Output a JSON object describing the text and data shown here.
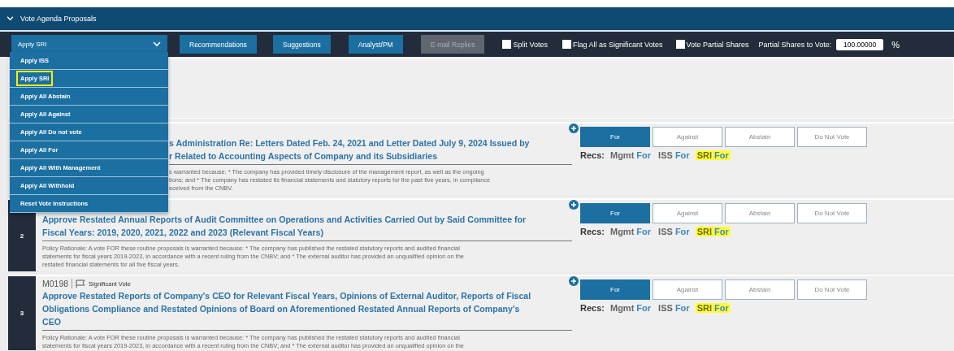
{
  "section": {
    "title": "Vote Agenda Proposals",
    "expanded": true
  },
  "toolbar": {
    "select": {
      "value": "Apply SRI",
      "open": true
    },
    "buttons": [
      {
        "label": "Recommendations",
        "disabled": false
      },
      {
        "label": "Suggestions",
        "disabled": false
      },
      {
        "label": "Analyst/PM",
        "disabled": false
      },
      {
        "label": "E-mail Replies",
        "disabled": true
      }
    ],
    "checkboxes": [
      {
        "label": "Split Votes",
        "checked": false
      },
      {
        "label": "Flag All as Significant Votes",
        "checked": false
      },
      {
        "label": "Vote Partial Shares",
        "checked": false
      }
    ],
    "partial_shares": {
      "label": "Partial Shares to Vote:",
      "value": "100.00000",
      "unit": "%"
    }
  },
  "dropdown": [
    {
      "label": "Apply ISS",
      "highlighted": false
    },
    {
      "label": "Apply SRI",
      "highlighted": true
    },
    {
      "label": "Apply All Abstain",
      "highlighted": false
    },
    {
      "label": "Apply All Against",
      "highlighted": false
    },
    {
      "label": "Apply All Do not vote",
      "highlighted": false
    },
    {
      "label": "Apply All For",
      "highlighted": false
    },
    {
      "label": "Apply All With Management",
      "highlighted": false
    },
    {
      "label": "Apply All Withhold",
      "highlighted": false
    },
    {
      "label": "Reset Vote Instructions",
      "highlighted": false
    }
  ],
  "proposals": [
    {
      "title": "s Administration Re: Letters Dated Feb. 24, 2021 and Letter Dated July 9, 2024 Issued by\nr Related to Accounting Aspects of Company and its Subsidiaries",
      "rationale": "s warranted because: * The company has provided timely disclosure of the management report, as well as the ongoing\ntions; and * The company has restated its financial statements and statutory reports for the past five years, in compliance\neceived from the CNBV.",
      "votes": [
        {
          "label": "For",
          "selected": true
        },
        {
          "label": "Against",
          "selected": false
        },
        {
          "label": "Abstain",
          "selected": false
        },
        {
          "label": "Do Not Vote",
          "selected": false
        }
      ],
      "recs_label": "Recs:",
      "recs": [
        {
          "source": "Mgmt",
          "value": "For",
          "highlighted": false
        },
        {
          "source": "ISS",
          "value": "For",
          "highlighted": false
        },
        {
          "source": "SRI",
          "value": "For",
          "highlighted": true
        }
      ]
    },
    {
      "number": "2",
      "title": "Approve Restated Annual Reports of Audit Committee on Operations and Activities Carried Out by Said Committee for\nFiscal Years: 2019, 2020, 2021, 2022 and 2023 (Relevant Fiscal Years)",
      "rationale": "Policy Rationale: A vote FOR these routine proposals is warranted because: * The company has published the restated statutory reports and audited financial\nstatements for fiscal years 2019-2023, in accordance with a recent ruling from the CNBV; and * The external auditor has provided an unqualified opinion on the\nrestated financial statements for all five fiscal years.",
      "votes": [
        {
          "label": "For",
          "selected": true
        },
        {
          "label": "Against",
          "selected": false
        },
        {
          "label": "Abstain",
          "selected": false
        },
        {
          "label": "Do Not Vote",
          "selected": false
        }
      ],
      "recs_label": "Recs:",
      "recs": [
        {
          "source": "Mgmt",
          "value": "For",
          "highlighted": false
        },
        {
          "source": "ISS",
          "value": "For",
          "highlighted": false
        },
        {
          "source": "SRI",
          "value": "For",
          "highlighted": true
        }
      ]
    },
    {
      "number": "3",
      "code": "M0198",
      "significant": true,
      "significant_label": "Significant Vote",
      "title": "Approve Restated Reports of Company's CEO for Relevant Fiscal Years, Opinions of External Auditor, Reports of Fiscal\nObligations Compliance and Restated Opinions of Board on Aforementioned Restated Annual Reports of Company's\nCEO",
      "rationale": "Policy Rationale: A vote FOR these routine proposals is warranted because: * The company has published the restated statutory reports and audited financial\nstatements for fiscal years 2019-2023, in accordance with a recent ruling from the CNBV; and * The external auditor has provided an unqualified opinion on the",
      "votes": [
        {
          "label": "For",
          "selected": true
        },
        {
          "label": "Against",
          "selected": false
        },
        {
          "label": "Abstain",
          "selected": false
        },
        {
          "label": "Do Not Vote",
          "selected": false
        }
      ],
      "recs_label": "Recs:",
      "recs": [
        {
          "source": "Mgmt",
          "value": "For",
          "highlighted": false
        },
        {
          "source": "ISS",
          "value": "For",
          "highlighted": false
        },
        {
          "source": "SRI",
          "value": "For",
          "highlighted": true
        }
      ]
    }
  ]
}
